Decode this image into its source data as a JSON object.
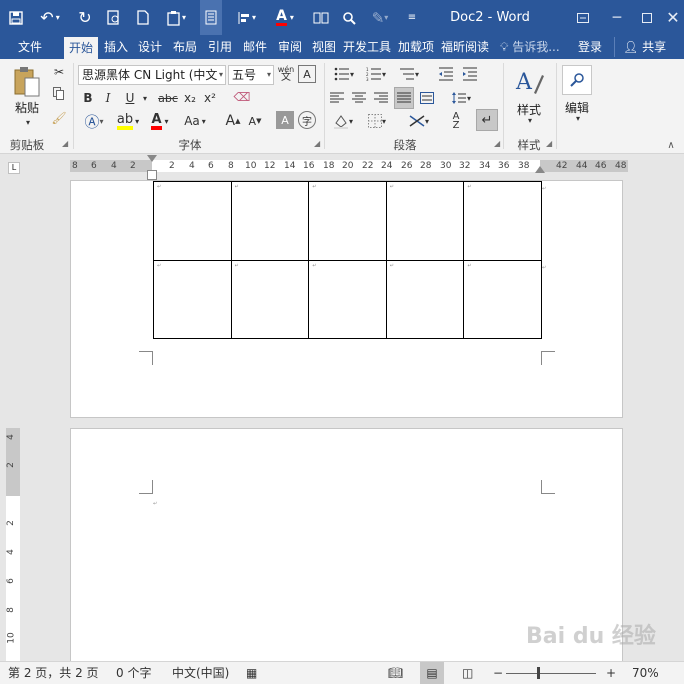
{
  "titlebar": {
    "title": "Doc2 - Word",
    "quick_access_icons": [
      "save-icon",
      "undo-icon",
      "redo-icon",
      "print-preview-icon",
      "new-doc-icon",
      "paste-icon",
      "view-icon",
      "align-icon",
      "font-color-icon",
      "columns-icon",
      "find-icon",
      "format-painter-icon",
      "customize-icon"
    ],
    "window_buttons": [
      "restore-ribbon-icon",
      "minimize-icon",
      "maximize-icon",
      "close-icon"
    ]
  },
  "tabs": [
    {
      "label": "文件"
    },
    {
      "label": "开始",
      "active": true
    },
    {
      "label": "插入"
    },
    {
      "label": "设计"
    },
    {
      "label": "布局"
    },
    {
      "label": "引用"
    },
    {
      "label": "邮件"
    },
    {
      "label": "审阅"
    },
    {
      "label": "视图"
    },
    {
      "label": "开发工具"
    },
    {
      "label": "加载项"
    },
    {
      "label": "福昕阅读"
    }
  ],
  "tell_me": "告诉我...",
  "signin": "登录",
  "share": "共享",
  "ribbon": {
    "clipboard": {
      "paste_label": "粘贴",
      "group_label": "剪贴板"
    },
    "font": {
      "font_name": "思源黑体 CN Light (中文",
      "font_size": "五号",
      "wen": "wén",
      "bold": "B",
      "italic": "I",
      "underline": "U",
      "strike": "abc",
      "sub": "x₂",
      "sup": "x²",
      "case": "Aa",
      "grow": "A",
      "shrink": "A",
      "group_label": "字体"
    },
    "paragraph": {
      "group_label": "段落"
    },
    "styles": {
      "label": "样式",
      "group_label": "样式"
    },
    "editing": {
      "label": "编辑"
    },
    "accent_color": "#2b579a",
    "font_color": "#ff0000",
    "highlight_color": "#ffff00"
  },
  "ruler": {
    "horizontal_ticks": [
      "8",
      "6",
      "4",
      "2",
      "2",
      "4",
      "6",
      "8",
      "10",
      "12",
      "14",
      "16",
      "18",
      "20",
      "22",
      "24",
      "26",
      "28",
      "30",
      "32",
      "34",
      "36",
      "38",
      "42",
      "44",
      "46",
      "48"
    ],
    "vertical_ticks": [
      "4",
      "2",
      "2",
      "4",
      "6",
      "8",
      "10"
    ],
    "tab_selector": "L"
  },
  "table": {
    "rows": 2,
    "cols": 5,
    "cell_mark": "↵"
  },
  "status": {
    "page": "第 2 页，共 2 页",
    "words": "0 个字",
    "language": "中文(中国)",
    "zoom": "70%",
    "zoom_minus": "−",
    "zoom_plus": "+"
  },
  "watermark": "Bai du 经验"
}
